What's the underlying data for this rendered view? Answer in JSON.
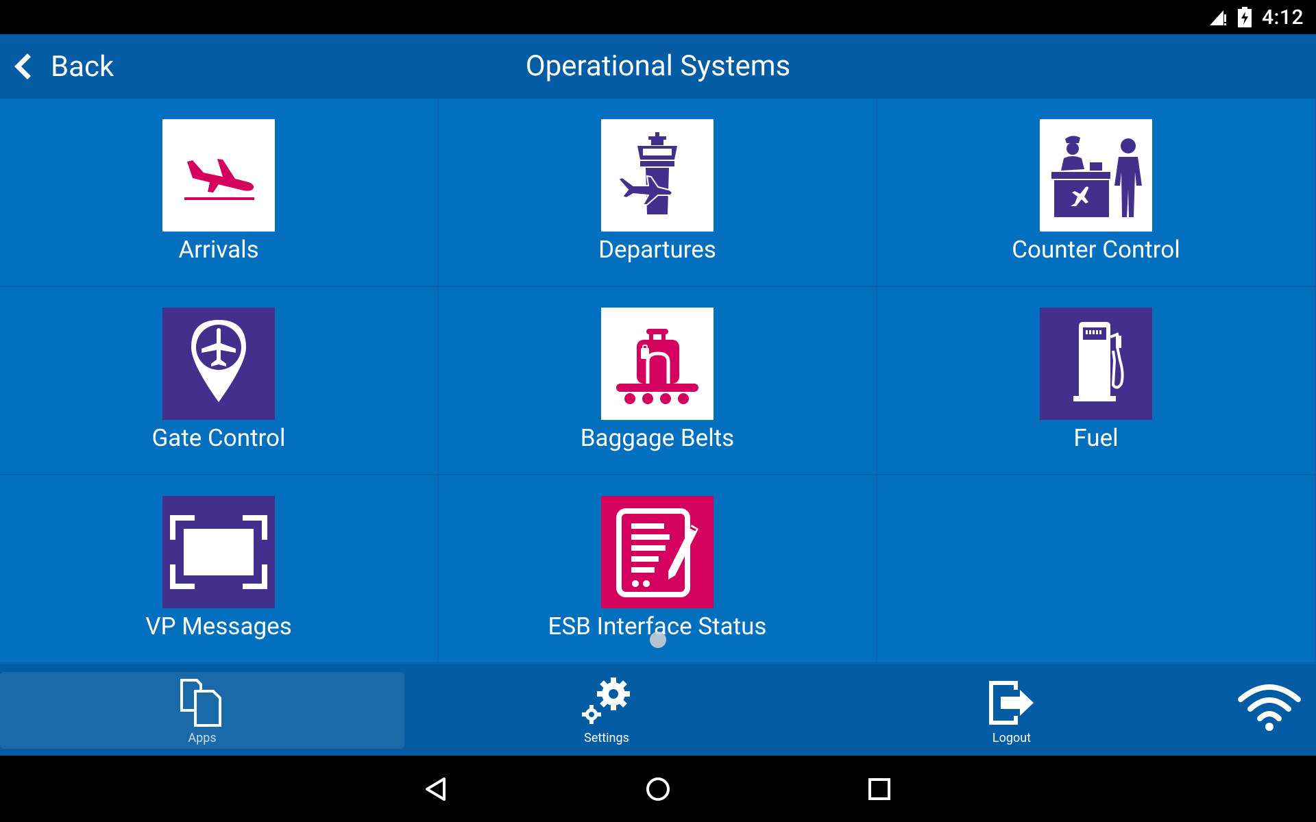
{
  "status_bar": {
    "time": "4:12",
    "icons": [
      "signal-icon",
      "battery-charging-icon"
    ]
  },
  "app_bar": {
    "back_label": "Back",
    "title": "Operational Systems"
  },
  "tiles": [
    {
      "label": "Arrivals",
      "icon": "arrivals-plane-icon",
      "bg": "#ffffff"
    },
    {
      "label": "Departures",
      "icon": "departures-tower-icon",
      "bg": "#ffffff"
    },
    {
      "label": "Counter Control",
      "icon": "check-in-counter-icon",
      "bg": "#ffffff"
    },
    {
      "label": "Gate Control",
      "icon": "gate-location-pin-icon",
      "bg": "#432f8c"
    },
    {
      "label": "Baggage Belts",
      "icon": "baggage-belt-icon",
      "bg": "#ffffff"
    },
    {
      "label": "Fuel",
      "icon": "fuel-pump-icon",
      "bg": "#432f8c"
    },
    {
      "label": "VP Messages",
      "icon": "screen-frame-icon",
      "bg": "#432f8c"
    },
    {
      "label": "ESB Interface Status",
      "icon": "document-edit-icon",
      "bg": "#d4025e"
    }
  ],
  "bottom_nav": {
    "apps_label": "Apps",
    "settings_label": "Settings",
    "logout_label": "Logout"
  },
  "colors": {
    "app_bar": "#045ca4",
    "tile": "#0270be",
    "accent_pink": "#d4025e",
    "accent_purple": "#432f8c"
  }
}
